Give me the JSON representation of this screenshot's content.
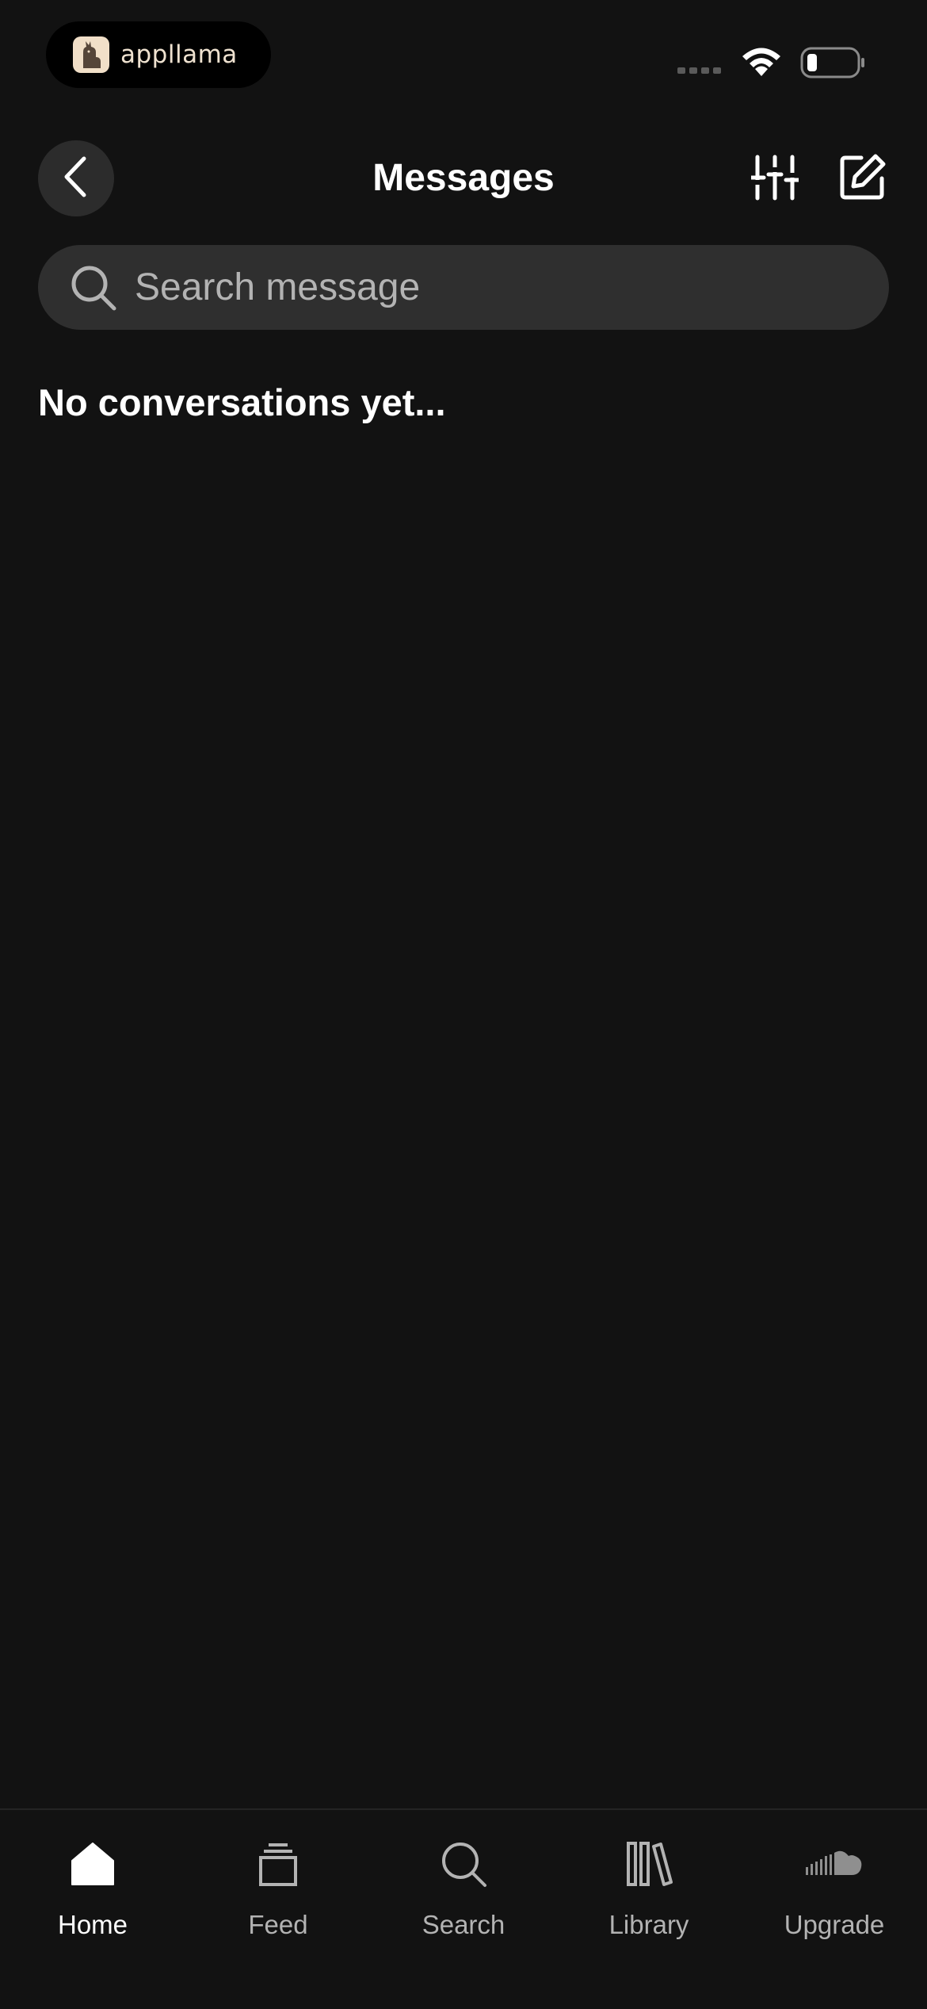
{
  "status_bar": {
    "brand_name": "appllama",
    "brand_icon": "llama-logo-icon",
    "icons": [
      "signal-icon",
      "wifi-icon",
      "battery-icon"
    ]
  },
  "header": {
    "title": "Messages",
    "back_icon": "chevron-left-icon",
    "filter_icon": "sliders-icon",
    "compose_icon": "compose-icon"
  },
  "search": {
    "placeholder": "Search message",
    "value": ""
  },
  "main": {
    "empty_message": "No conversations yet..."
  },
  "bottom_nav": {
    "items": [
      {
        "label": "Home",
        "icon": "home-icon",
        "active": true
      },
      {
        "label": "Feed",
        "icon": "feed-icon",
        "active": false
      },
      {
        "label": "Search",
        "icon": "search-icon",
        "active": false
      },
      {
        "label": "Library",
        "icon": "library-icon",
        "active": false
      },
      {
        "label": "Upgrade",
        "icon": "soundcloud-icon",
        "active": false
      }
    ]
  },
  "colors": {
    "background": "#121212",
    "surface": "#2f2f2f",
    "text_primary": "#ffffff",
    "text_secondary": "#b3b3b3"
  }
}
